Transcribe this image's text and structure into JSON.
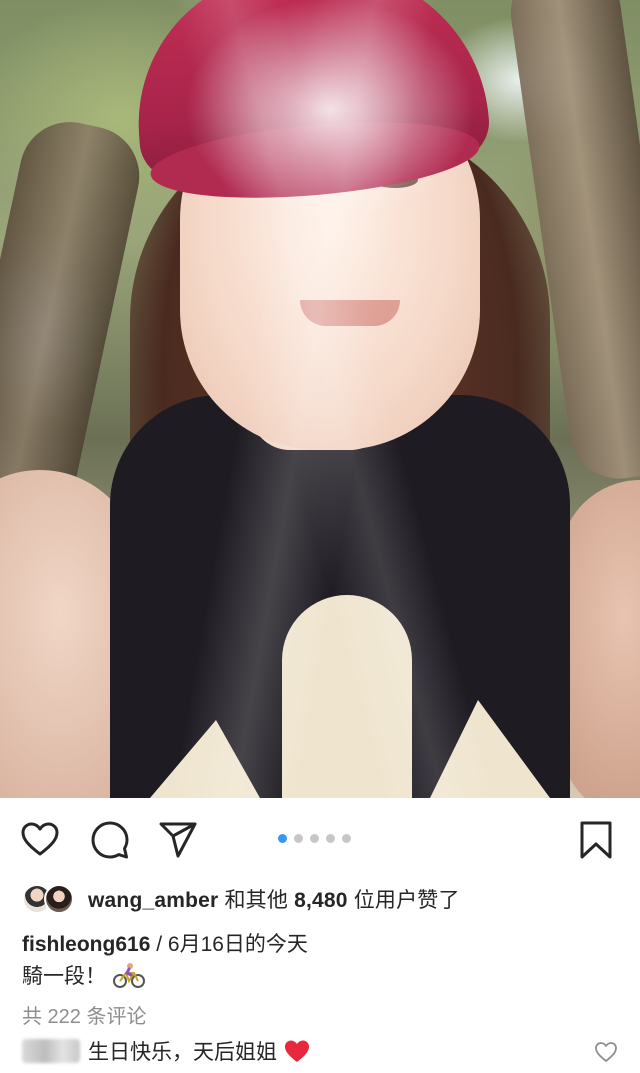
{
  "post": {
    "pagination": {
      "total": 5,
      "current": 1
    },
    "likes": {
      "username": "wang_amber",
      "connector": "和其他",
      "count": "8,480",
      "suffix": "位用户赞了"
    },
    "caption": {
      "username": "fishleong616",
      "separator": " / ",
      "memory": "6月16日的今天",
      "text": "騎一段！",
      "emoji": "bicyclist"
    },
    "comments": {
      "view_all": "共 222 条评论",
      "first": {
        "text": "生日快乐，天后姐姐",
        "emoji": "red-heart"
      }
    },
    "icons": {
      "like": "heart-icon",
      "comment": "comment-icon",
      "share": "share-icon",
      "save": "bookmark-icon"
    },
    "colors": {
      "active_dot": "#3897f0",
      "inactive_dot": "#c7c7c7",
      "heart_red": "#e8283c",
      "text": "#262626",
      "muted": "#8e8e8e"
    }
  }
}
